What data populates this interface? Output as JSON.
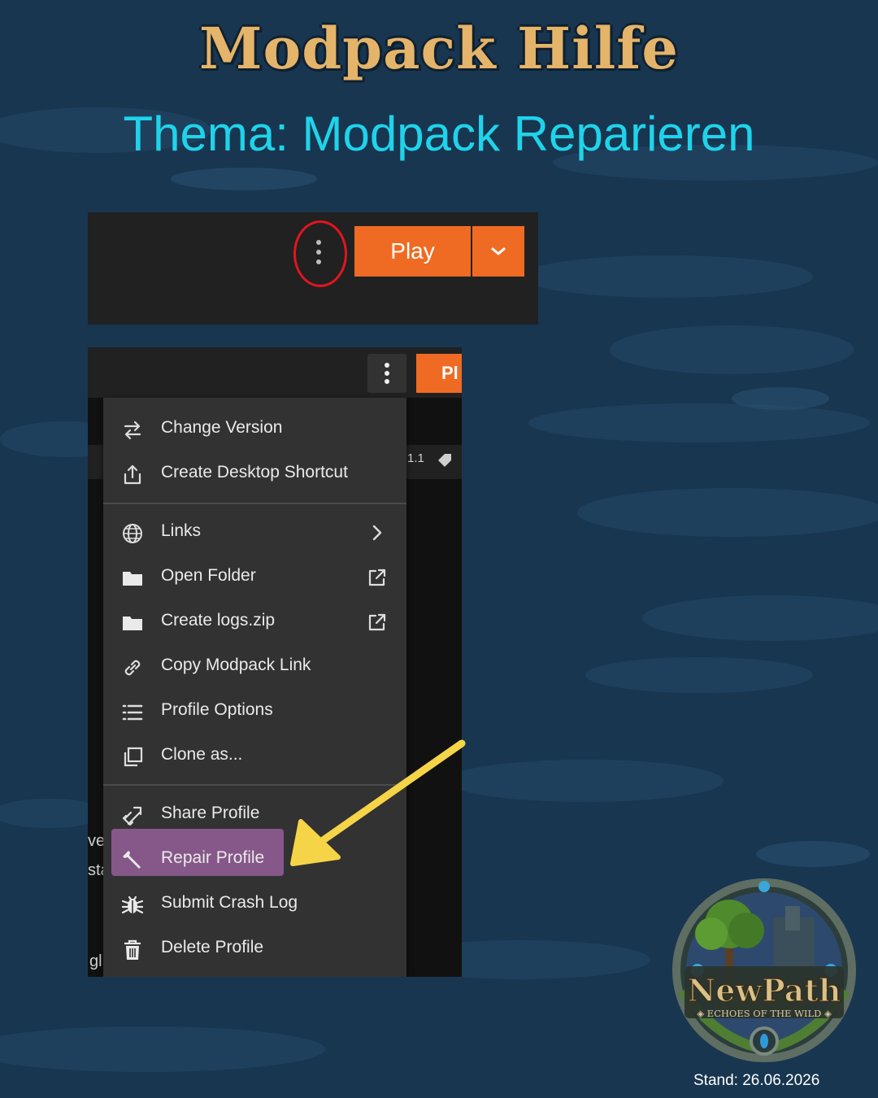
{
  "page": {
    "title": "Modpack Hilfe",
    "subtitle": "Thema: Modpack Reparieren",
    "stand": "Stand: 26.06.2026"
  },
  "colors": {
    "background": "#183650",
    "title": "#e4b46a",
    "subtitle": "#1fd3ea",
    "play_button": "#ef6b23",
    "menu_bg": "#323232",
    "highlight": "#8b5a8e",
    "arrow": "#f5d547",
    "callout_ring": "#e2151e"
  },
  "screenshot_top": {
    "play_label": "Play",
    "kebab_icon": "vertical-ellipsis-icon",
    "caret_icon": "chevron-down-icon"
  },
  "screenshot_bottom": {
    "play_label": "Pl",
    "fragments": {
      "version": "1.1",
      "left1": "ve",
      "left2": "sta",
      "left3": "gl"
    },
    "menu": {
      "group1": [
        {
          "label": "Change Version",
          "icon": "swap-arrows-icon"
        },
        {
          "label": "Create Desktop Shortcut",
          "icon": "share-upload-icon"
        }
      ],
      "group2": [
        {
          "label": "Links",
          "icon": "globe-icon",
          "right": "chevron-right-icon"
        },
        {
          "label": "Open Folder",
          "icon": "folder-icon",
          "right": "external-link-icon"
        },
        {
          "label": "Create logs.zip",
          "icon": "folder-icon",
          "right": "external-link-icon"
        },
        {
          "label": "Copy Modpack Link",
          "icon": "link-icon"
        },
        {
          "label": "Profile Options",
          "icon": "list-icon"
        },
        {
          "label": "Clone as...",
          "icon": "copy-icon"
        }
      ],
      "group3": [
        {
          "label": "Share Profile",
          "icon": "share-link-icon"
        },
        {
          "label": "Repair Profile",
          "icon": "wrench-icon",
          "highlighted": true
        },
        {
          "label": "Submit Crash Log",
          "icon": "bug-icon"
        },
        {
          "label": "Delete Profile",
          "icon": "trash-icon"
        }
      ]
    }
  },
  "logo": {
    "name": "NewPath",
    "tagline": "ECHOES OF THE WILD"
  }
}
